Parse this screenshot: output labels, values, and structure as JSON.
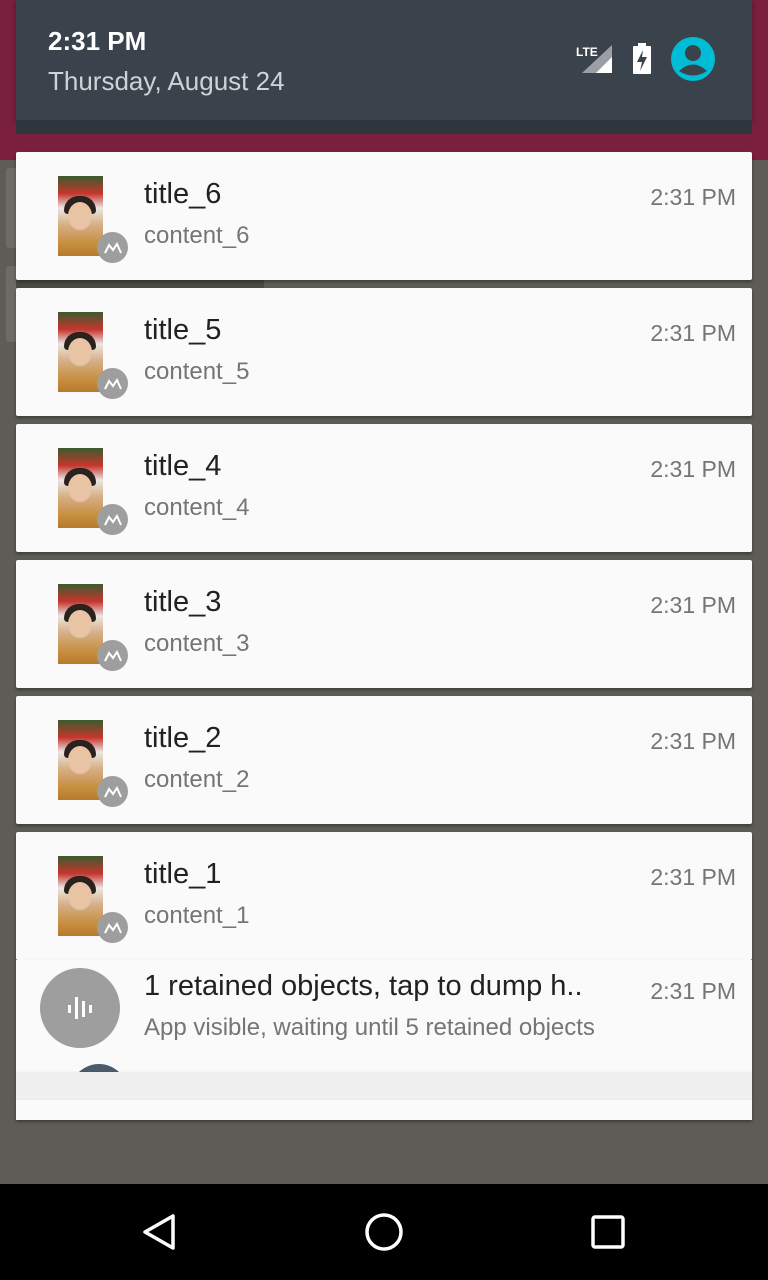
{
  "status": {
    "time": "2:31 PM",
    "date": "Thursday, August 24",
    "network_label": "LTE",
    "icons": [
      "signal-icon",
      "battery-charging-icon",
      "user-account-icon"
    ]
  },
  "notifications": [
    {
      "title": "title_6",
      "content": "content_6",
      "time": "2:31 PM"
    },
    {
      "title": "title_5",
      "content": "content_5",
      "time": "2:31 PM"
    },
    {
      "title": "title_4",
      "content": "content_4",
      "time": "2:31 PM"
    },
    {
      "title": "title_3",
      "content": "content_3",
      "time": "2:31 PM"
    },
    {
      "title": "title_2",
      "content": "content_2",
      "time": "2:31 PM"
    },
    {
      "title": "title_1",
      "content": "content_1",
      "time": "2:31 PM"
    }
  ],
  "leak_notification": {
    "title": "1 retained objects, tap to dump h..",
    "content": "App visible, waiting until 5 retained objects",
    "time": "2:31 PM"
  },
  "navigation": {
    "buttons": [
      "back-icon",
      "home-icon",
      "recents-icon"
    ]
  },
  "colors": {
    "shade_header": "#3a424b",
    "accent_avatar": "#00bcd4",
    "card_background": "#fafafa",
    "badge_gray": "#9e9e9e"
  }
}
